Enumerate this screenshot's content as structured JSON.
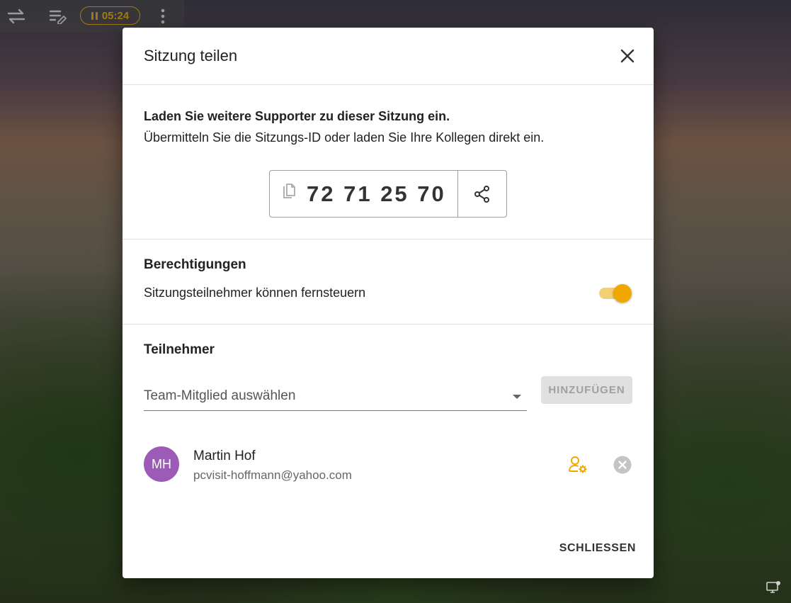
{
  "toolbar": {
    "timer": "05:24",
    "icons": [
      "swap-icon",
      "edit-list-icon",
      "pause-icon",
      "more-vert-icon"
    ]
  },
  "dialog": {
    "title": "Sitzung teilen",
    "invite_heading": "Laden Sie weitere Supporter zu dieser Sitzung ein.",
    "invite_text": "Übermitteln Sie die Sitzungs-ID oder laden Sie Ihre Kollegen direkt ein.",
    "session_id": "72 71 25 70",
    "permissions": {
      "heading": "Berechtigungen",
      "remote_control_label": "Sitzungsteilnehmer können fernsteuern",
      "remote_control_enabled": true
    },
    "participants": {
      "heading": "Teilnehmer",
      "select_placeholder": "Team-Mitglied auswählen",
      "add_button": "HINZUFÜGEN",
      "members": [
        {
          "initials": "MH",
          "name": "Martin Hof",
          "email": "pcvisit-hoffmann@yahoo.com"
        }
      ]
    },
    "close_button": "SCHLIESSEN"
  },
  "colors": {
    "accent": "#f0a800",
    "avatar": "#9b5bb7",
    "disabled_button": "#e0e0e0"
  }
}
